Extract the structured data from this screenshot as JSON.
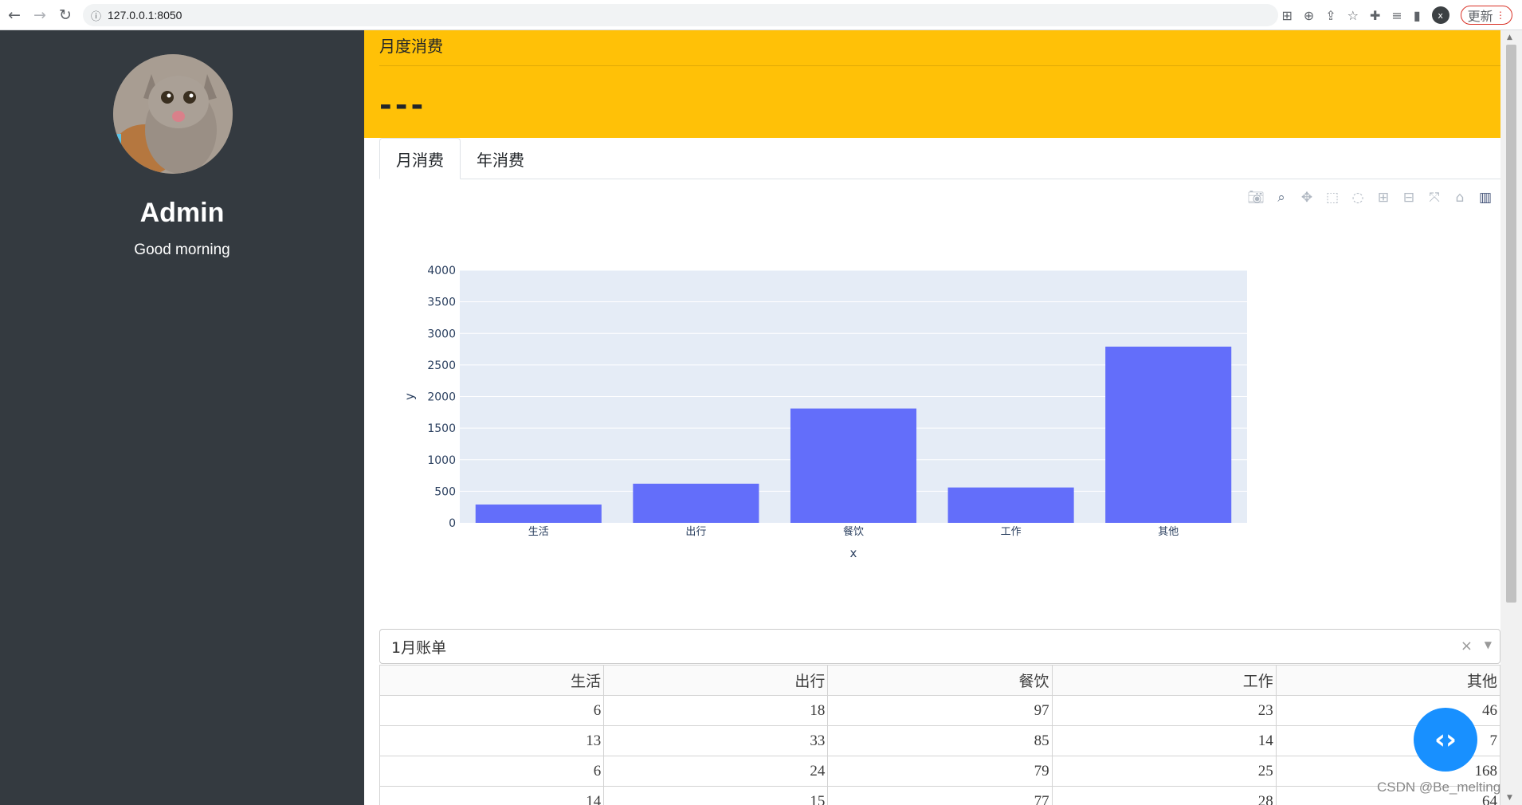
{
  "browser": {
    "url": "127.0.0.1:8050",
    "update_label": "更新",
    "profile_initial": "x"
  },
  "sidebar": {
    "name": "Admin",
    "greeting": "Good morning"
  },
  "banner": {
    "title": "月度消费",
    "value": "---"
  },
  "tabs": [
    {
      "label": "月消费",
      "active": true
    },
    {
      "label": "年消费",
      "active": false
    }
  ],
  "chart_data": {
    "type": "bar",
    "categories": [
      "生活",
      "出行",
      "餐饮",
      "工作",
      "其他"
    ],
    "values": [
      290,
      620,
      1810,
      560,
      2790
    ],
    "xlabel": "x",
    "ylabel": "y",
    "ylim": [
      0,
      4000
    ],
    "yticks": [
      0,
      500,
      1000,
      1500,
      2000,
      2500,
      3000,
      3500,
      4000
    ],
    "bar_color": "#636efa",
    "plot_bg": "#e5ecf6",
    "grid": true
  },
  "dropdown": {
    "value": "1月账单",
    "clear_symbol": "×",
    "arrow_symbol": "▼"
  },
  "table": {
    "columns": [
      "生活",
      "出行",
      "餐饮",
      "工作",
      "其他"
    ],
    "rows": [
      [
        "6",
        "18",
        "97",
        "23",
        "46"
      ],
      [
        "13",
        "33",
        "85",
        "14",
        "7"
      ],
      [
        "6",
        "24",
        "79",
        "25",
        "168"
      ],
      [
        "14",
        "15",
        "77",
        "28",
        "64"
      ]
    ]
  },
  "watermark": "CSDN @Be_melting",
  "colors": {
    "sidebar": "#343a40",
    "banner": "#ffc107",
    "fab": "#1890ff"
  }
}
